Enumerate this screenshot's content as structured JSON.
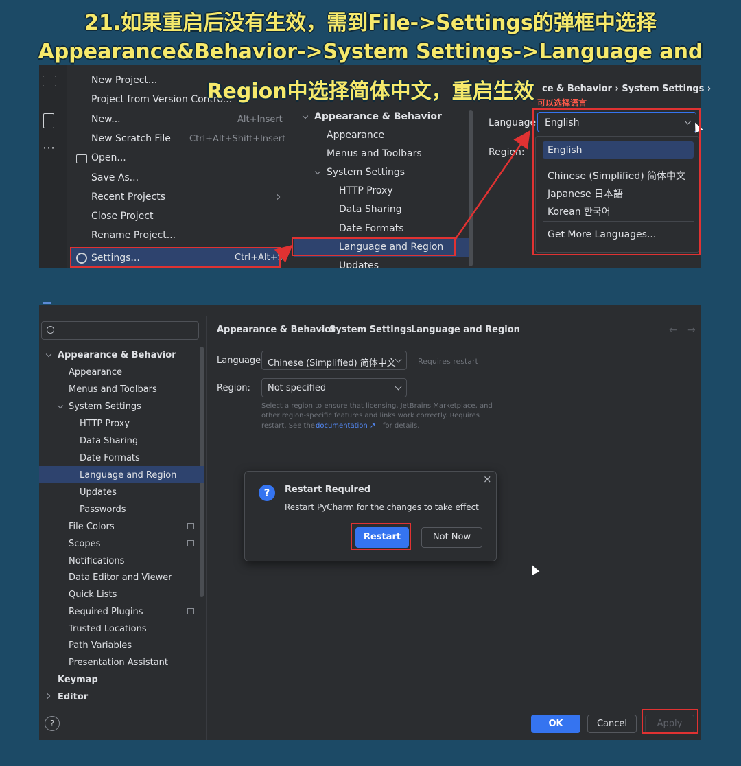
{
  "caption": {
    "line1": "21.如果重启后没有生效，需到File->Settings的弹框中选择",
    "line2": "Appearance&Behavior->System Settings->Language and",
    "line3": "Region中选择简体中文，重启生效"
  },
  "top": {
    "file_menu": [
      {
        "label": "New Project...",
        "shortcut": ""
      },
      {
        "label": "Project from Version Contro...",
        "shortcut": ""
      },
      {
        "label": "New...",
        "shortcut": "Alt+Insert"
      },
      {
        "label": "New Scratch File",
        "shortcut": "Ctrl+Alt+Shift+Insert"
      },
      {
        "label": "Open...",
        "shortcut": ""
      },
      {
        "label": "Save As...",
        "shortcut": ""
      },
      {
        "label": "Recent Projects",
        "shortcut": ""
      },
      {
        "label": "Close Project",
        "shortcut": ""
      },
      {
        "label": "Rename Project...",
        "shortcut": ""
      },
      {
        "label": "Settings...",
        "shortcut": "Ctrl+Alt+S"
      }
    ],
    "tree": [
      "Appearance & Behavior",
      "Appearance",
      "Menus and Toolbars",
      "System Settings",
      "HTTP Proxy",
      "Data Sharing",
      "Date Formats",
      "Language and Region",
      "Updates"
    ],
    "breadcrumb": "ce & Behavior  ›  System Settings  ›",
    "annotation": "可以选择语言",
    "language_label": "Language:",
    "region_label": "Region:",
    "language_value": "English",
    "languages": [
      "English",
      "Chinese (Simplified) 简体中文",
      "Japanese 日本語",
      "Korean 한국어",
      "Get More Languages..."
    ]
  },
  "bottom": {
    "tree": [
      "Appearance & Behavior",
      "Appearance",
      "Menus and Toolbars",
      "System Settings",
      "HTTP Proxy",
      "Data Sharing",
      "Date Formats",
      "Language and Region",
      "Updates",
      "Passwords",
      "File Colors",
      "Scopes",
      "Notifications",
      "Data Editor and Viewer",
      "Quick Lists",
      "Required Plugins",
      "Trusted Locations",
      "Path Variables",
      "Presentation Assistant",
      "Keymap",
      "Editor"
    ],
    "breadcrumb": [
      "Appearance & Behavior",
      "System Settings",
      "Language and Region"
    ],
    "language_label": "Language:",
    "language_value": "Chinese (Simplified) 简体中文",
    "requires_restart": "Requires restart",
    "region_label": "Region:",
    "region_value": "Not specified",
    "help_text_1": "Select a region to ensure that licensing, JetBrains Marketplace, and",
    "help_text_2": "other region-specific features and links work correctly. Requires",
    "help_text_3a": "restart. See the",
    "help_link": "documentation ↗",
    "help_text_3b": "for details.",
    "dialog": {
      "title": "Restart Required",
      "message": "Restart PyCharm for the changes to take effect",
      "restart": "Restart",
      "not_now": "Not Now"
    },
    "ok": "OK",
    "cancel": "Cancel",
    "apply": "Apply",
    "help": "?"
  },
  "colors": {
    "red": "#e03232",
    "accent": "#3574f0",
    "caption": "#f6e96b"
  }
}
